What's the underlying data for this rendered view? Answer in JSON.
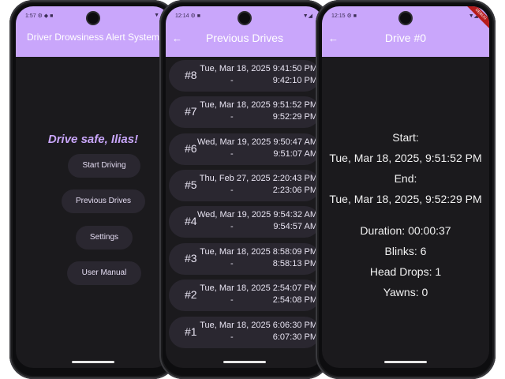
{
  "phone1": {
    "status_time": "1:57",
    "app_title": "Driver Drowsiness Alert System",
    "greeting": "Drive safe, Ilias!",
    "buttons": {
      "start_driving": "Start Driving",
      "previous_drives": "Previous Drives",
      "settings": "Settings",
      "user_manual": "User Manual"
    }
  },
  "phone2": {
    "status_time": "12:14",
    "title": "Previous Drives",
    "drives": [
      {
        "num": "#8",
        "start": "Tue, Mar 18, 2025 9:41:50 PM",
        "dash": "-",
        "end": "9:42:10 PM"
      },
      {
        "num": "#7",
        "start": "Tue, Mar 18, 2025 9:51:52 PM",
        "dash": "-",
        "end": "9:52:29 PM"
      },
      {
        "num": "#6",
        "start": "Wed, Mar 19, 2025 9:50:47 AM",
        "dash": "-",
        "end": "9:51:07 AM"
      },
      {
        "num": "#5",
        "start": "Thu, Feb 27, 2025 2:20:43 PM",
        "dash": "-",
        "end": "2:23:06 PM"
      },
      {
        "num": "#4",
        "start": "Wed, Mar 19, 2025 9:54:32 AM",
        "dash": "-",
        "end": "9:54:57 AM"
      },
      {
        "num": "#3",
        "start": "Tue, Mar 18, 2025 8:58:09 PM",
        "dash": "-",
        "end": "8:58:13 PM"
      },
      {
        "num": "#2",
        "start": "Tue, Mar 18, 2025 2:54:07 PM",
        "dash": "-",
        "end": "2:54:08 PM"
      },
      {
        "num": "#1",
        "start": "Tue, Mar 18, 2025 6:06:30 PM",
        "dash": "-",
        "end": "6:07:30 PM"
      }
    ]
  },
  "phone3": {
    "status_time": "12:15",
    "title": "Drive #0",
    "debug_label": "DEBUG",
    "start_label": "Start:",
    "start_value": "Tue, Mar 18, 2025, 9:51:52 PM",
    "end_label": "End:",
    "end_value": "Tue, Mar 18, 2025, 9:52:29 PM",
    "duration": "Duration: 00:00:37",
    "blinks": "Blinks: 6",
    "head_drops": "Head Drops: 1",
    "yawns": "Yawns: 0"
  },
  "colors": {
    "accent": "#c9a6fb",
    "background": "#1b1a1d",
    "button_bg": "#2a2730"
  }
}
